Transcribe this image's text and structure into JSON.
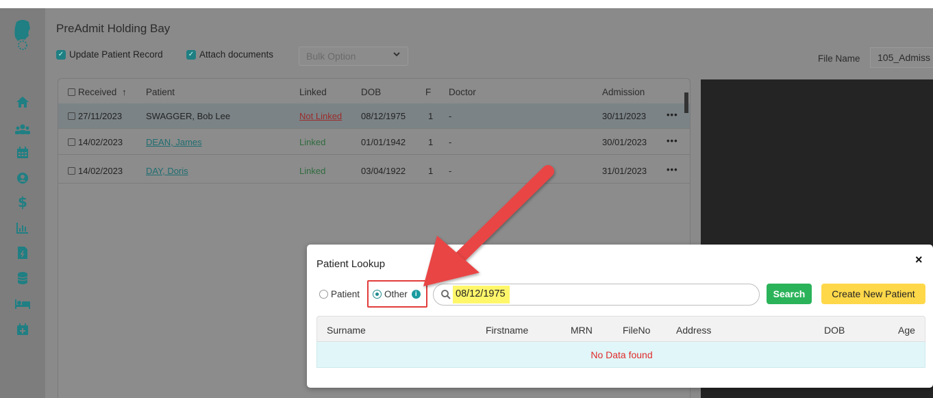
{
  "page": {
    "title": "PreAdmit Holding Bay",
    "options": {
      "update_patient_record": "Update Patient Record",
      "attach_documents": "Attach documents",
      "bulk_option": "Bulk Option"
    },
    "file_name_label": "File Name",
    "file_name_value": "105_Admiss"
  },
  "sidebar": {
    "icons": [
      "home-icon",
      "users-icon",
      "calendar-icon",
      "user-circle-icon",
      "dollar-icon",
      "chart-icon",
      "document-icon",
      "database-icon",
      "bed-icon",
      "calendar-plus-icon"
    ]
  },
  "table": {
    "headers": {
      "received": "Received",
      "sort_arrow": "↑",
      "patient": "Patient",
      "linked": "Linked",
      "dob": "DOB",
      "f": "F",
      "doctor": "Doctor",
      "admission": "Admission"
    },
    "rows": [
      {
        "received": "27/11/2023",
        "patient": "SWAGGER, Bob Lee",
        "linked": "Not Linked",
        "dob": "08/12/1975",
        "f": "1",
        "doctor": "-",
        "admission": "30/11/2023",
        "menu": "•••"
      },
      {
        "received": "14/02/2023",
        "patient": "DEAN, James",
        "linked": "Linked",
        "dob": "01/01/1942",
        "f": "1",
        "doctor": "-",
        "admission": "30/01/2023",
        "menu": "•••"
      },
      {
        "received": "14/02/2023",
        "patient": "DAY, Doris",
        "linked": "Linked",
        "dob": "03/04/1922",
        "f": "1",
        "doctor": "-",
        "admission": "31/01/2023",
        "menu": "•••"
      }
    ]
  },
  "modal": {
    "title": "Patient Lookup",
    "close": "×",
    "radio_patient": "Patient",
    "radio_other": "Other",
    "info": "i",
    "search_value": "08/12/1975",
    "search_button": "Search",
    "create_button": "Create New Patient",
    "columns": {
      "surname": "Surname",
      "firstname": "Firstname",
      "mrn": "MRN",
      "fileno": "FileNo",
      "address": "Address",
      "dob": "DOB",
      "age": "Age"
    },
    "empty_message": "No Data found"
  },
  "colors": {
    "accent_teal": "#1f8a8f",
    "search_green": "#2bb35a",
    "create_yellow": "#ffd84a",
    "highlight_yellow": "#fff66a",
    "annotation_red": "#e23b3b",
    "nodata_red": "#e02a2a"
  }
}
